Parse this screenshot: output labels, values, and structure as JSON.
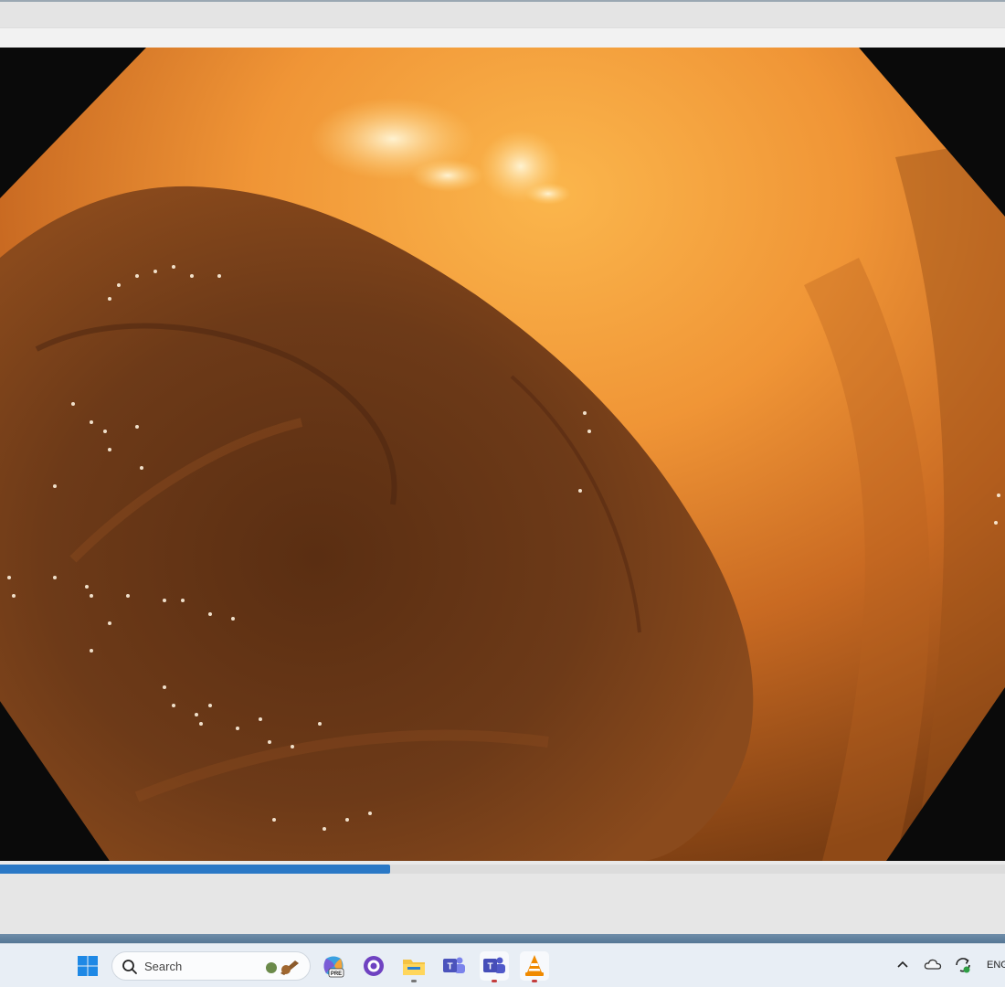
{
  "window": {
    "seek_progress": 0.388
  },
  "video": {
    "content": "endoscopy-frame"
  },
  "taskbar": {
    "search_placeholder": "Search",
    "apps": [
      {
        "icon": "windows-start-icon"
      },
      {
        "icon": "copilot-preview-icon",
        "badge": "PRE"
      },
      {
        "icon": "github-desktop-icon"
      },
      {
        "icon": "file-explorer-icon"
      },
      {
        "icon": "teams-icon"
      },
      {
        "icon": "teams-work-icon"
      },
      {
        "icon": "vlc-icon"
      }
    ],
    "tray": {
      "language": "ENG"
    }
  },
  "colors": {
    "seek_fill": "#2a78c6",
    "taskbar_bg": "#e8eef5"
  }
}
